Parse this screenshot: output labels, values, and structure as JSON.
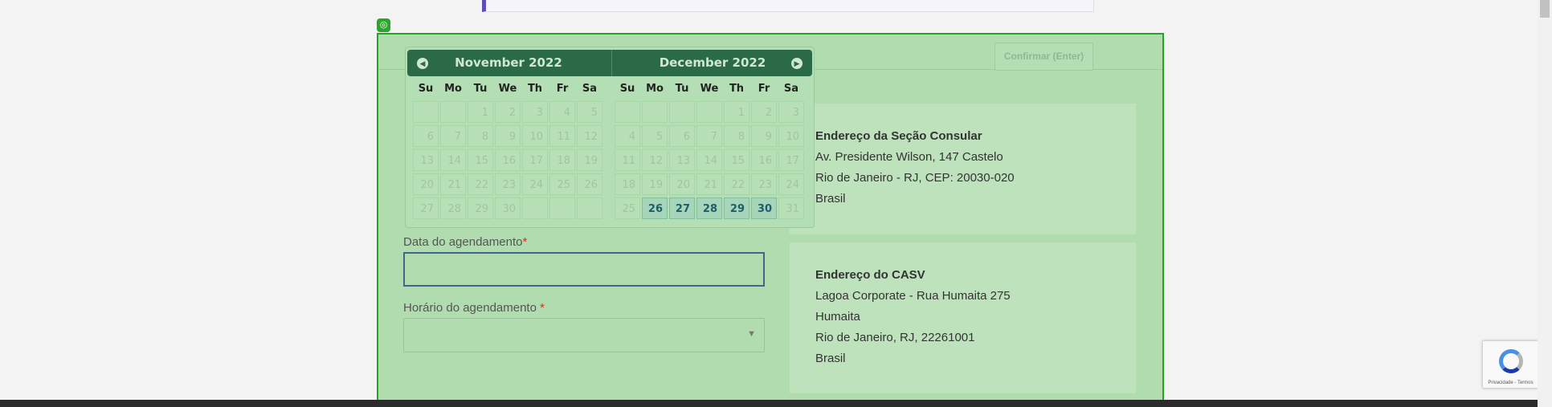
{
  "form": {
    "confirm_label": "Confirmar (Enter)",
    "date_label": "Data do agendamento",
    "date_required": "*",
    "date_value": "",
    "time_label": "Horário do agendamento",
    "time_required": "*",
    "time_value": ""
  },
  "datepicker": {
    "left_month": "November  2022",
    "right_month": "December  2022",
    "weekdays": [
      "Su",
      "Mo",
      "Tu",
      "We",
      "Th",
      "Fr",
      "Sa"
    ],
    "november": [
      [
        "",
        "",
        "1",
        "2",
        "3",
        "4",
        "5"
      ],
      [
        "6",
        "7",
        "8",
        "9",
        "10",
        "11",
        "12"
      ],
      [
        "13",
        "14",
        "15",
        "16",
        "17",
        "18",
        "19"
      ],
      [
        "20",
        "21",
        "22",
        "23",
        "24",
        "25",
        "26"
      ],
      [
        "27",
        "28",
        "29",
        "30",
        "",
        "",
        ""
      ]
    ],
    "december": [
      [
        "",
        "",
        "",
        "",
        "1",
        "2",
        "3"
      ],
      [
        "4",
        "5",
        "6",
        "7",
        "8",
        "9",
        "10"
      ],
      [
        "11",
        "12",
        "13",
        "14",
        "15",
        "16",
        "17"
      ],
      [
        "18",
        "19",
        "20",
        "21",
        "22",
        "23",
        "24"
      ],
      [
        "25",
        "26",
        "27",
        "28",
        "29",
        "30",
        "31"
      ]
    ],
    "available_december": [
      "26",
      "27",
      "28",
      "29",
      "30"
    ]
  },
  "consular_address": {
    "title": "Endereço da Seção Consular",
    "line1": "Av. Presidente Wilson, 147 Castelo",
    "line2": "Rio de Janeiro - RJ, CEP: 20030-020",
    "line3": "Brasil"
  },
  "casv_address": {
    "title": "Endereço do CASV",
    "line1": "Lagoa Corporate - Rua Humaita 275",
    "line2": "Humaita",
    "line3": "Rio de Janeiro, RJ, 22261001",
    "line4": "Brasil"
  },
  "recaptcha": {
    "footer": "Privacidade - Termos"
  },
  "icons": {
    "prev": "chevron-left-icon",
    "next": "chevron-right-icon",
    "dropdown": "caret-down-icon"
  }
}
